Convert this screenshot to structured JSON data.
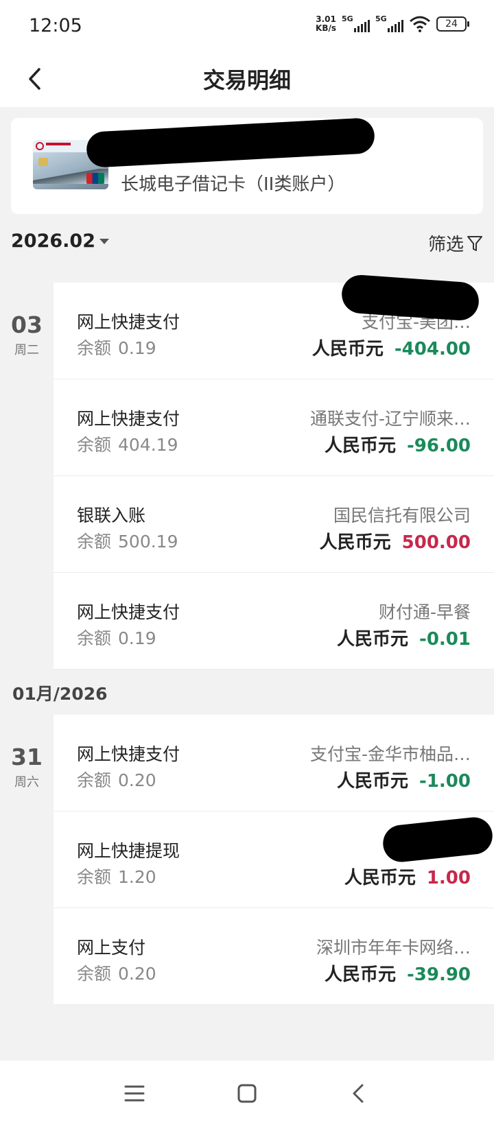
{
  "status_bar": {
    "time": "12:05",
    "net_speed_value": "3.01",
    "net_speed_unit": "KB/s",
    "signal_1": "5G",
    "signal_2": "5G",
    "battery": "24"
  },
  "header": {
    "title": "交易明细"
  },
  "account": {
    "card_name": "长城电子借记卡（II类账户）"
  },
  "filter_bar": {
    "month": "2026.02",
    "filter_label": "筛选"
  },
  "groups": [
    {
      "day": "03",
      "weekday": "周二",
      "transactions": [
        {
          "type": "网上快捷支付",
          "balance_label": "余额",
          "balance": "0.19",
          "merchant": "支付宝-美团…",
          "currency": "人民币元",
          "amount": "-404.00",
          "sign": "neg"
        },
        {
          "type": "网上快捷支付",
          "balance_label": "余额",
          "balance": "404.19",
          "merchant": "通联支付-辽宁顺来…",
          "currency": "人民币元",
          "amount": "-96.00",
          "sign": "neg"
        },
        {
          "type": "银联入账",
          "balance_label": "余额",
          "balance": "500.19",
          "merchant": "国民信托有限公司",
          "currency": "人民币元",
          "amount": "500.00",
          "sign": "pos"
        },
        {
          "type": "网上快捷支付",
          "balance_label": "余额",
          "balance": "0.19",
          "merchant": "财付通-早餐",
          "currency": "人民币元",
          "amount": "-0.01",
          "sign": "neg"
        }
      ]
    },
    {
      "month_header": "01月/2026",
      "day": "31",
      "weekday": "周六",
      "transactions": [
        {
          "type": "网上快捷支付",
          "balance_label": "余额",
          "balance": "0.20",
          "merchant": "支付宝-金华市柚品…",
          "currency": "人民币元",
          "amount": "-1.00",
          "sign": "neg"
        },
        {
          "type": "网上快捷提现",
          "balance_label": "余额",
          "balance": "1.20",
          "merchant": "",
          "currency": "人民币元",
          "amount": "1.00",
          "sign": "pos"
        },
        {
          "type": "网上支付",
          "balance_label": "余额",
          "balance": "0.20",
          "merchant": "深圳市年年卡网络…",
          "currency": "人民币元",
          "amount": "-39.90",
          "sign": "neg"
        }
      ]
    }
  ],
  "colors": {
    "negative": "#1a8a5a",
    "positive": "#c8284b",
    "background": "#f2f2f2"
  },
  "icons": {
    "back": "chevron-left-icon",
    "filter": "funnel-icon",
    "dropdown": "caret-down-icon",
    "menu": "menu-icon",
    "home": "home-square-icon",
    "nav_back": "nav-back-icon"
  }
}
